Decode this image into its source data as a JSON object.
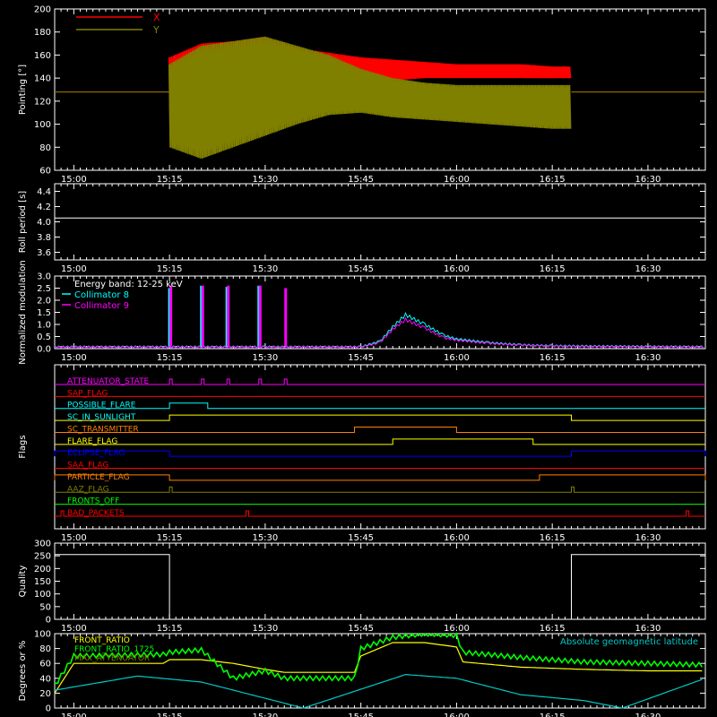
{
  "chart_data": [
    {
      "type": "line",
      "ylabel": "Pointing [°]",
      "ylim": [
        60,
        200
      ],
      "yticks": [
        60,
        80,
        100,
        120,
        140,
        160,
        180,
        200
      ],
      "x_tick_labels": [
        "15:00",
        "15:15",
        "15:30",
        "15:45",
        "16:00",
        "16:15",
        "16:30"
      ],
      "legend": [
        {
          "name": "X",
          "color": "#ff0000"
        },
        {
          "name": "Y",
          "color": "#808000"
        }
      ],
      "series": [
        {
          "name": "X",
          "color": "#ff0000",
          "x": [
            "15:15",
            "15:20",
            "15:25",
            "15:30",
            "15:35",
            "15:40",
            "15:45",
            "15:50",
            "15:55",
            "16:00",
            "16:05",
            "16:10",
            "16:15",
            "16:18"
          ],
          "upper": [
            158,
            170,
            172,
            176,
            166,
            162,
            158,
            156,
            154,
            152,
            152,
            152,
            150,
            150
          ],
          "lower": [
            88,
            78,
            90,
            100,
            112,
            124,
            134,
            138,
            140,
            140,
            140,
            140,
            140,
            140
          ],
          "baseline": 128
        },
        {
          "name": "Y",
          "color": "#808000",
          "x": [
            "15:15",
            "15:20",
            "15:25",
            "15:30",
            "15:35",
            "15:40",
            "15:45",
            "15:50",
            "15:55",
            "16:00",
            "16:05",
            "16:10",
            "16:15",
            "16:18"
          ],
          "upper": [
            152,
            168,
            172,
            176,
            168,
            160,
            148,
            140,
            136,
            134,
            134,
            134,
            134,
            134
          ],
          "lower": [
            80,
            70,
            80,
            90,
            100,
            108,
            110,
            106,
            104,
            102,
            100,
            98,
            96,
            96
          ],
          "baseline": 128
        }
      ]
    },
    {
      "type": "line",
      "ylabel": "Roll period [s]",
      "ylim": [
        3.5,
        4.5
      ],
      "yticks": [
        3.6,
        3.8,
        4.0,
        4.2,
        4.4
      ],
      "x_tick_labels": [
        "15:00",
        "15:15",
        "15:30",
        "15:45",
        "16:00",
        "16:15",
        "16:30"
      ],
      "series": [
        {
          "name": "",
          "color": "#ffffff",
          "x": [
            "14:57",
            "16:39"
          ],
          "y": [
            4.05,
            4.05
          ]
        }
      ]
    },
    {
      "type": "line",
      "ylabel": "Normalized modulation",
      "ylim": [
        0,
        3
      ],
      "yticks": [
        0.0,
        0.5,
        1.0,
        1.5,
        2.0,
        2.5,
        3.0
      ],
      "x_tick_labels": [
        "15:00",
        "15:15",
        "15:30",
        "15:45",
        "16:00",
        "16:15",
        "16:30"
      ],
      "annotation": "Energy band: 12-25 keV",
      "legend": [
        {
          "name": "Collimator 8",
          "color": "#00ffff"
        },
        {
          "name": "Collimator 9",
          "color": "#ff00ff"
        }
      ],
      "series": [
        {
          "name": "Collimator 8",
          "color": "#00ffff",
          "x": [
            "14:57",
            "15:15",
            "15:30",
            "15:45",
            "15:48",
            "15:50",
            "15:52",
            "15:55",
            "15:58",
            "16:00",
            "16:05",
            "16:10",
            "16:15",
            "16:25",
            "16:39"
          ],
          "y": [
            0.08,
            0.08,
            0.08,
            0.08,
            0.3,
            0.9,
            1.4,
            1.0,
            0.55,
            0.4,
            0.25,
            0.16,
            0.12,
            0.1,
            0.08
          ],
          "spikes": [
            {
              "x": "15:15",
              "y": 2.5
            },
            {
              "x": "15:20",
              "y": 2.6
            },
            {
              "x": "15:24",
              "y": 2.55
            },
            {
              "x": "15:29",
              "y": 2.6
            }
          ]
        },
        {
          "name": "Collimator 9",
          "color": "#ff00ff",
          "x": [
            "14:57",
            "15:15",
            "15:30",
            "15:45",
            "15:48",
            "15:50",
            "15:52",
            "15:55",
            "15:58",
            "16:00",
            "16:05",
            "16:10",
            "16:15",
            "16:25",
            "16:39"
          ],
          "y": [
            0.06,
            0.06,
            0.06,
            0.06,
            0.25,
            0.8,
            1.2,
            0.85,
            0.45,
            0.35,
            0.22,
            0.14,
            0.1,
            0.08,
            0.06
          ],
          "spikes": [
            {
              "x": "15:15",
              "y": 2.6
            },
            {
              "x": "15:20",
              "y": 2.6
            },
            {
              "x": "15:24",
              "y": 2.6
            },
            {
              "x": "15:29",
              "y": 2.6
            },
            {
              "x": "15:33",
              "y": 2.5
            }
          ]
        }
      ]
    },
    {
      "type": "table",
      "ylabel": "Flags",
      "x_tick_labels": [
        "15:00",
        "15:15",
        "15:30",
        "15:45",
        "16:00",
        "16:15",
        "16:30"
      ],
      "flags": [
        {
          "name": "ATTENUATOR_STATE",
          "color": "#ff00ff",
          "on": [
            [
              "15:15",
              "15:15"
            ],
            [
              "15:20",
              "15:20"
            ],
            [
              "15:24",
              "15:24"
            ],
            [
              "15:29",
              "15:29"
            ],
            [
              "15:33",
              "15:33"
            ]
          ]
        },
        {
          "name": "SAP_FLAG",
          "color": "#ff0000",
          "on": []
        },
        {
          "name": "POSSIBLE_FLARE",
          "color": "#00ffff",
          "on": [
            [
              "15:15",
              "15:21"
            ]
          ]
        },
        {
          "name": "SC_IN_SUNLIGHT",
          "color": "#00ffff",
          "on": [
            [
              "15:15",
              "16:18"
            ]
          ],
          "line_color": "#ffff00"
        },
        {
          "name": "SC_TRANSMITTER",
          "color": "#ff8000",
          "on": [
            [
              "15:44",
              "16:00"
            ]
          ]
        },
        {
          "name": "FLARE_FLAG",
          "color": "#ffff00",
          "on": [
            [
              "15:50",
              "16:12"
            ]
          ]
        },
        {
          "name": "ECLIPSE_FLAG",
          "color": "#0000ff",
          "on": [
            [
              "14:57",
              "15:15"
            ],
            [
              "16:18",
              "16:39"
            ]
          ]
        },
        {
          "name": "SAA_FLAG",
          "color": "#ff0000",
          "on": []
        },
        {
          "name": "PARTICLE_FLAG",
          "color": "#ff8000",
          "on": [
            [
              "14:57",
              "15:15"
            ],
            [
              "16:13",
              "16:39"
            ]
          ]
        },
        {
          "name": "AAZ_FLAG",
          "color": "#808000",
          "on": [
            [
              "15:15",
              "15:15"
            ],
            [
              "16:18",
              "16:18"
            ]
          ]
        },
        {
          "name": "FRONTS_OFF",
          "color": "#00ff00",
          "on": []
        },
        {
          "name": "BAD_PACKETS",
          "color": "#ff0000",
          "on": [
            [
              "14:58",
              "14:58"
            ],
            [
              "15:27",
              "15:27"
            ],
            [
              "16:36",
              "16:36"
            ]
          ]
        }
      ]
    },
    {
      "type": "line",
      "ylabel": "Quality",
      "ylim": [
        0,
        300
      ],
      "yticks": [
        0,
        50,
        100,
        150,
        200,
        250,
        300
      ],
      "x_tick_labels": [
        "15:00",
        "15:15",
        "15:30",
        "15:45",
        "16:00",
        "16:15",
        "16:30"
      ],
      "series": [
        {
          "name": "",
          "color": "#ffffff",
          "x": [
            "14:57",
            "15:15",
            "15:15",
            "16:18",
            "16:18",
            "16:39"
          ],
          "y": [
            255,
            255,
            0,
            0,
            255,
            255
          ]
        }
      ]
    },
    {
      "type": "line",
      "ylabel": "Degrees or %",
      "ylim": [
        0,
        100
      ],
      "yticks": [
        0,
        20,
        40,
        60,
        80,
        100
      ],
      "x_tick_labels": [
        "15:00",
        "15:15",
        "15:30",
        "15:45",
        "16:00",
        "16:15",
        "16:30"
      ],
      "legend": [
        {
          "name": "FRONT_RATIO",
          "color": "#ffff00"
        },
        {
          "name": "FRONT_RATIO_1725",
          "color": "#00ff00"
        },
        {
          "name": "MAX_ATTENUATOR",
          "color": "#808000"
        }
      ],
      "annotation": "Absolute geomagnetic latitude",
      "series": [
        {
          "name": "FRONT_RATIO",
          "color": "#ffff00",
          "x": [
            "14:57",
            "15:00",
            "15:14",
            "15:15",
            "15:20",
            "15:25",
            "15:30",
            "15:33",
            "15:40",
            "15:44",
            "15:45",
            "15:50",
            "15:55",
            "16:00",
            "16:01",
            "16:10",
            "16:20",
            "16:30",
            "16:39"
          ],
          "y": [
            20,
            60,
            60,
            65,
            65,
            60,
            52,
            48,
            48,
            48,
            70,
            88,
            88,
            82,
            62,
            55,
            52,
            50,
            50
          ]
        },
        {
          "name": "FRONT_RATIO_1725",
          "color": "#00ff00",
          "x": [
            "14:57",
            "15:00",
            "15:14",
            "15:15",
            "15:20",
            "15:25",
            "15:30",
            "15:33",
            "15:40",
            "15:44",
            "15:45",
            "15:50",
            "15:55",
            "16:00",
            "16:01",
            "16:10",
            "16:20",
            "16:30",
            "16:39"
          ],
          "y": [
            30,
            70,
            72,
            75,
            78,
            40,
            50,
            40,
            40,
            40,
            80,
            95,
            100,
            98,
            75,
            68,
            62,
            60,
            58
          ]
        },
        {
          "name": "Absolute geomagnetic latitude",
          "color": "#00c8c8",
          "x": [
            "14:57",
            "15:10",
            "15:20",
            "15:36",
            "15:52",
            "16:00",
            "16:10",
            "16:20",
            "16:26",
            "16:39"
          ],
          "y": [
            24,
            43,
            35,
            0,
            45,
            40,
            18,
            10,
            0,
            40
          ]
        }
      ]
    }
  ]
}
